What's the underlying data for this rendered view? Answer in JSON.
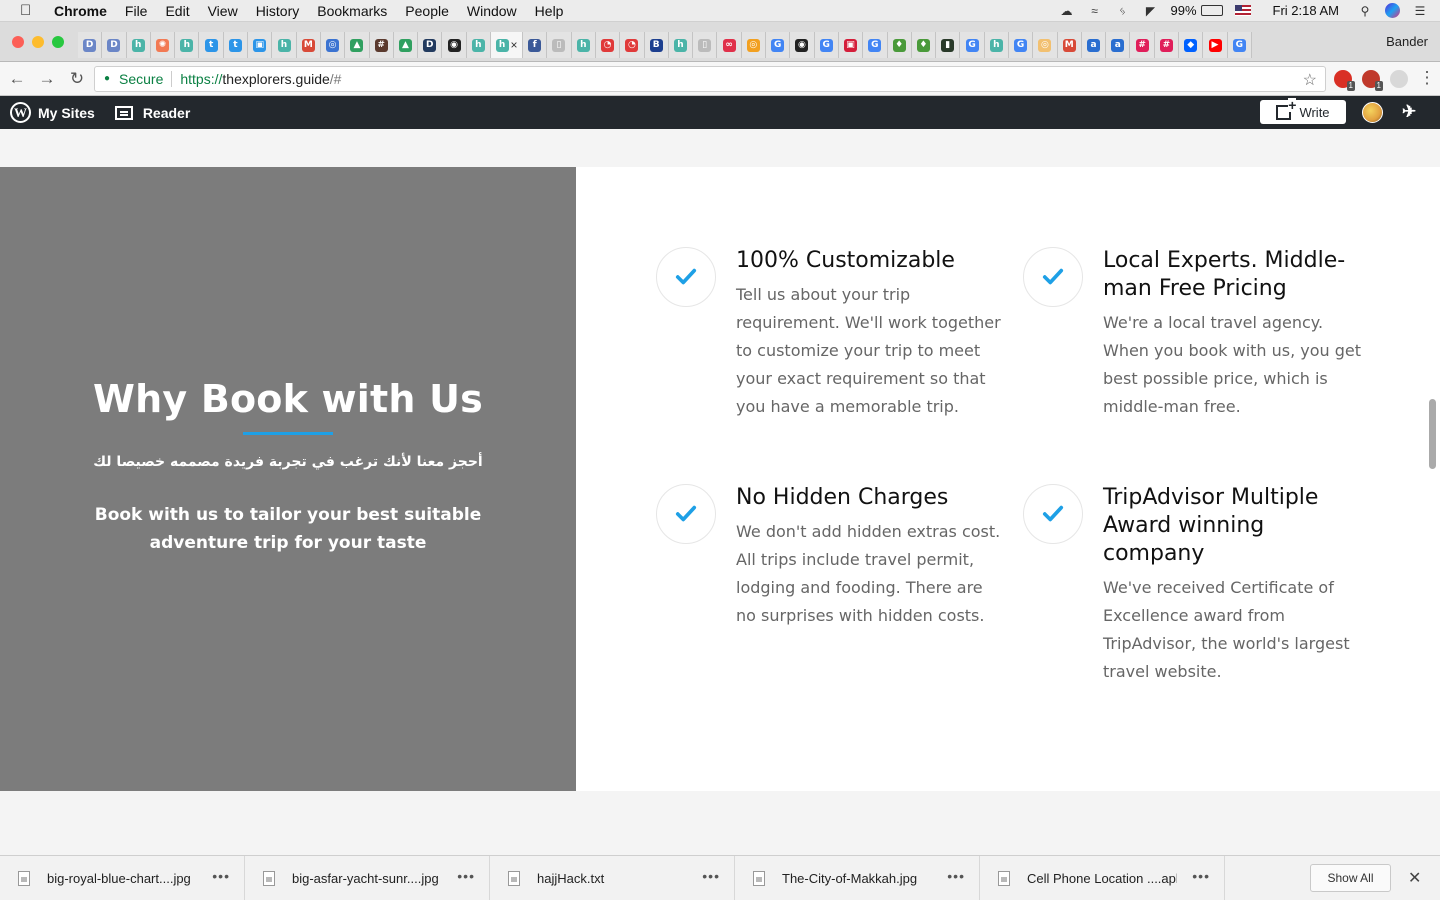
{
  "menubar": {
    "app": "Chrome",
    "items": [
      "File",
      "Edit",
      "View",
      "History",
      "Bookmarks",
      "People",
      "Window",
      "Help"
    ],
    "battery": "99%",
    "clock": "Fri 2:18 AM",
    "icons": [
      "creative-cloud-icon",
      "wifi-dual-icon",
      "bluetooth-icon",
      "wifi-icon",
      "battery-icon",
      "us-flag-icon",
      "spotlight-icon",
      "siri-icon",
      "notification-center-icon"
    ]
  },
  "browser": {
    "profile_name": "Bander",
    "url_scheme": "https://",
    "url_host": "thexplorers.guide",
    "url_rest": "/#",
    "secure_label": "Secure",
    "favicons": [
      {
        "glyph": "D",
        "color": "#6b86c7"
      },
      {
        "glyph": "D",
        "color": "#6b86c7"
      },
      {
        "glyph": "h",
        "color": "#4bb4a8"
      },
      {
        "glyph": "✺",
        "color": "#f27a54"
      },
      {
        "glyph": "h",
        "color": "#4bb4a8"
      },
      {
        "glyph": "t",
        "color": "#2c95e8"
      },
      {
        "glyph": "t",
        "color": "#2c95e8"
      },
      {
        "glyph": "▣",
        "color": "#2c95e8"
      },
      {
        "glyph": "h",
        "color": "#4bb4a8"
      },
      {
        "glyph": "M",
        "color": "#d84a38"
      },
      {
        "glyph": "◎",
        "color": "#3b73d1"
      },
      {
        "glyph": "▲",
        "color": "#30a060"
      },
      {
        "glyph": "#",
        "color": "#5b3a2e"
      },
      {
        "glyph": "▲",
        "color": "#30a060"
      },
      {
        "glyph": "D",
        "color": "#223a5e"
      },
      {
        "glyph": "◉",
        "color": "#222222"
      },
      {
        "glyph": "h",
        "color": "#4bb4a8"
      },
      {
        "glyph": "h",
        "color": "#4bb4a8"
      },
      {
        "glyph": "f",
        "color": "#3b5998"
      },
      {
        "glyph": "▯",
        "color": "#bbbbbb"
      },
      {
        "glyph": "h",
        "color": "#4bb4a8"
      },
      {
        "glyph": "◔",
        "color": "#e03a3a"
      },
      {
        "glyph": "◔",
        "color": "#e03a3a"
      },
      {
        "glyph": "B",
        "color": "#1d3f8f"
      },
      {
        "glyph": "h",
        "color": "#4bb4a8"
      },
      {
        "glyph": "▯",
        "color": "#bbbbbb"
      },
      {
        "glyph": "∞",
        "color": "#e0304a"
      },
      {
        "glyph": "◎",
        "color": "#f2a020"
      },
      {
        "glyph": "G",
        "color": "#4285f4"
      },
      {
        "glyph": "◉",
        "color": "#222222"
      },
      {
        "glyph": "G",
        "color": "#4285f4"
      },
      {
        "glyph": "▣",
        "color": "#d41e3a"
      },
      {
        "glyph": "G",
        "color": "#4285f4"
      },
      {
        "glyph": "♦",
        "color": "#4a9a3a"
      },
      {
        "glyph": "♦",
        "color": "#4a9a3a"
      },
      {
        "glyph": "▮",
        "color": "#2a3a2a"
      },
      {
        "glyph": "G",
        "color": "#4285f4"
      },
      {
        "glyph": "h",
        "color": "#4bb4a8"
      },
      {
        "glyph": "G",
        "color": "#4285f4"
      },
      {
        "glyph": "◎",
        "color": "#f2c070"
      },
      {
        "glyph": "M",
        "color": "#d84a38"
      },
      {
        "glyph": "a",
        "color": "#2a6ed0"
      },
      {
        "glyph": "a",
        "color": "#2a6ed0"
      },
      {
        "glyph": "#",
        "color": "#e01e5a"
      },
      {
        "glyph": "#",
        "color": "#e01e5a"
      },
      {
        "glyph": "◆",
        "color": "#0061ff"
      },
      {
        "glyph": "▶",
        "color": "#ff0000"
      },
      {
        "glyph": "G",
        "color": "#4285f4"
      }
    ]
  },
  "masterbar": {
    "my_sites": "My Sites",
    "reader": "Reader",
    "write": "Write"
  },
  "section": {
    "title": "Why Book with Us",
    "arabic": "أحجز معنا لأنك ترغب في تجربة فريدة مصممه خصيصا لك",
    "subtitle": "Book with us to tailor your best suitable adventure trip for your taste",
    "features": [
      {
        "title": "100% Customizable",
        "body": "Tell us about your trip requirement. We'll work together to customize your trip to meet your exact requirement so that you have a memorable trip."
      },
      {
        "title": "Local Experts. Middle-man Free Pricing",
        "body": "We're a local travel agency. When you book with us, you get best possible price, which is middle-man free."
      },
      {
        "title": "No Hidden Charges",
        "body": "We don't add hidden extras cost. All trips include travel permit, lodging and fooding. There are no surprises with hidden costs."
      },
      {
        "title": "TripAdvisor Multiple Award winning company",
        "body": "We've received Certificate of Excellence award from TripAdvisor, the world's largest travel website."
      }
    ]
  },
  "downloads": {
    "items": [
      {
        "name": "big-royal-blue-chart....jpg",
        "type": "image"
      },
      {
        "name": "big-asfar-yacht-sunr....jpg",
        "type": "image"
      },
      {
        "name": "hajjHack.txt",
        "type": "text"
      },
      {
        "name": "The-City-of-Makkah.jpg",
        "type": "image"
      },
      {
        "name": "Cell Phone Location ....apk",
        "type": "file"
      }
    ],
    "show_all": "Show All"
  },
  "colors": {
    "accent": "#1ea0e6",
    "left_panel": "#7c7c7c",
    "masterbar": "#23282d"
  }
}
